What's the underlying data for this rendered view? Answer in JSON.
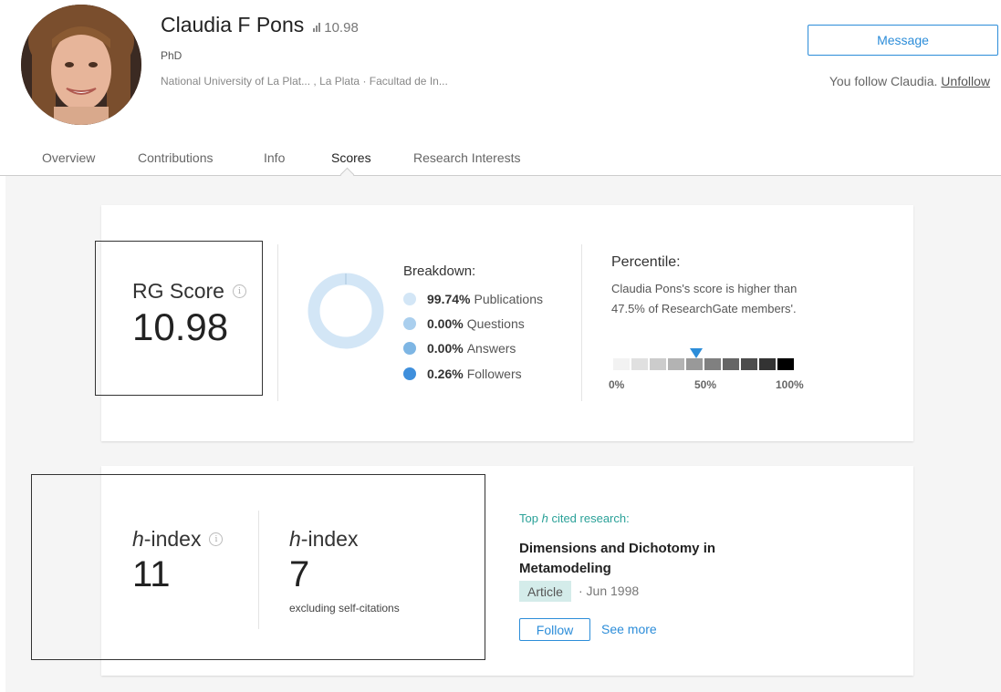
{
  "profile": {
    "name": "Claudia F Pons",
    "score_mini": "10.98",
    "degree": "PhD",
    "affiliation": "National University of La Plat... , La Plata · Facultad de In...",
    "message_label": "Message",
    "follow_status": "You follow Claudia.",
    "unfollow_label": "Unfollow"
  },
  "tabs": [
    {
      "label": "Overview"
    },
    {
      "label": "Contributions"
    },
    {
      "label": "Info"
    },
    {
      "label": "Scores",
      "active": true
    },
    {
      "label": "Research Interests"
    }
  ],
  "rg_score": {
    "label": "RG Score",
    "value": "10.98"
  },
  "breakdown": {
    "title": "Breakdown:",
    "items": [
      {
        "value": "99.74%",
        "label": "Publications",
        "color": "#d3e6f6"
      },
      {
        "value": "0.00%",
        "label": "Questions",
        "color": "#aacfee"
      },
      {
        "value": "0.00%",
        "label": "Answers",
        "color": "#7eb6e4"
      },
      {
        "value": "0.26%",
        "label": "Followers",
        "color": "#3f8fdc"
      }
    ]
  },
  "percentile": {
    "title": "Percentile:",
    "description": "Claudia Pons's score is higher than 47.5% of ResearchGate members'.",
    "value": 0.475,
    "labels": [
      "0%",
      "50%",
      "100%"
    ],
    "marker_color": "#2c8dd9"
  },
  "hindex": {
    "label": "-index",
    "label_italic": "h",
    "value": "11",
    "excl_value": "7",
    "excl_note": "excluding self-citations"
  },
  "top_research": {
    "label_prefix": "Top",
    "label_italic": "h",
    "label_suffix": "cited research:",
    "title": "Dimensions and Dichotomy in Metamodeling",
    "type": "Article",
    "date": "· Jun 1998",
    "follow_label": "Follow",
    "see_more_label": "See more"
  },
  "colors": {
    "accent": "#2c8dd9",
    "teal": "#2aa198",
    "badge_bg": "#d4ecea"
  }
}
